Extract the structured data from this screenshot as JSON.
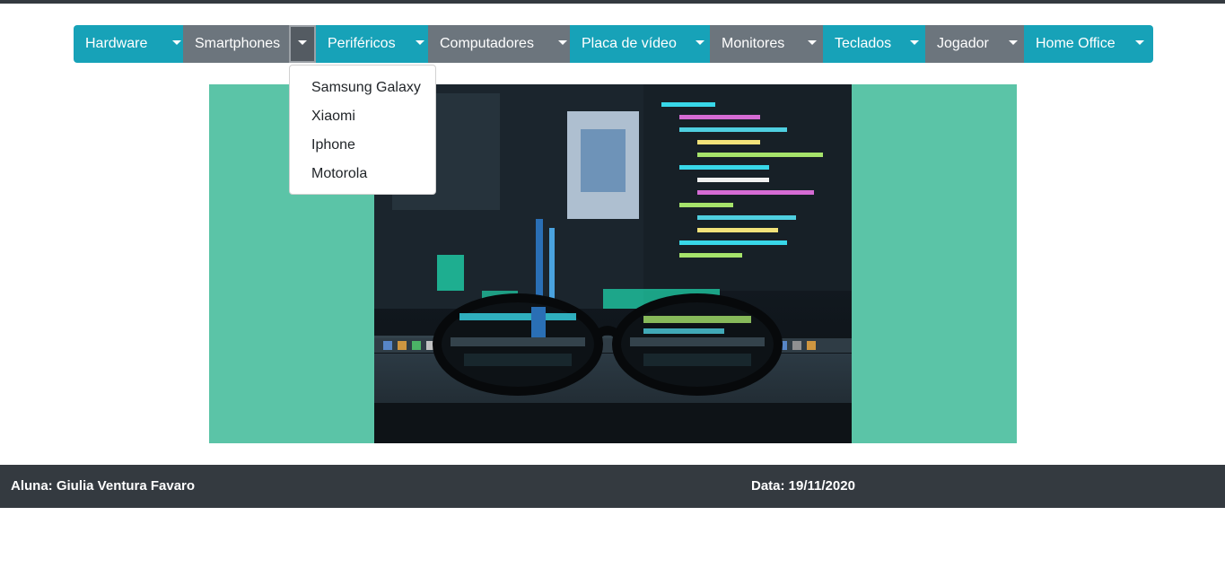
{
  "nav": {
    "menus": [
      {
        "label": "Hardware",
        "variant": "info"
      },
      {
        "label": "Smartphones",
        "variant": "secondary",
        "open": true
      },
      {
        "label": "Periféricos",
        "variant": "info"
      },
      {
        "label": "Computadores",
        "variant": "secondary"
      },
      {
        "label": "Placa de vídeo",
        "variant": "info"
      },
      {
        "label": "Monitores",
        "variant": "secondary"
      },
      {
        "label": "Teclados",
        "variant": "info"
      },
      {
        "label": "Jogador",
        "variant": "secondary"
      },
      {
        "label": "Home Office",
        "variant": "info"
      }
    ],
    "toggle_icon": "caret-down-icon"
  },
  "dropdown": {
    "items": [
      "Samsung Galaxy",
      "Xiaomi",
      "Iphone",
      "Motorola"
    ]
  },
  "hero": {
    "background_color": "#5bc4a7",
    "photo_subject": "eyeglasses in front of monitors with code"
  },
  "footer": {
    "student": "Aluna: Giulia Ventura Favaro",
    "date": "Data: 19/11/2020"
  },
  "colors": {
    "info": "#17a2b8",
    "secondary": "#6c757d",
    "footer": "#343a40"
  }
}
